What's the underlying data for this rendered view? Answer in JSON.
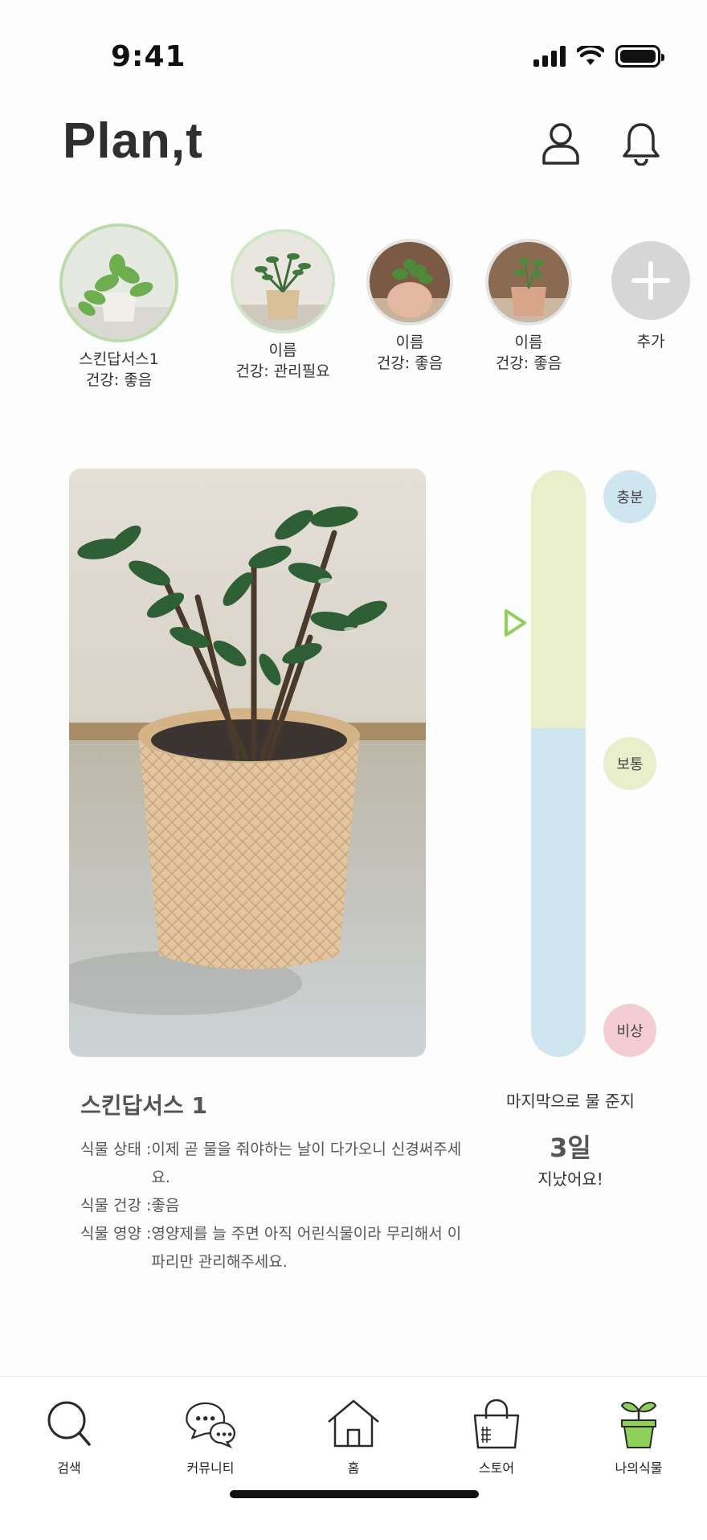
{
  "status_bar": {
    "time": "9:41"
  },
  "header": {
    "title": "Plan,t",
    "profile_icon": "profile-icon",
    "bell_icon": "bell-icon"
  },
  "plants": [
    {
      "name": "스킨답서스1",
      "health": "건강: 좋음",
      "selected": true
    },
    {
      "name": "이름",
      "health": "건강: 관리필요",
      "selected": false
    },
    {
      "name": "이름",
      "health": "건강: 좋음",
      "selected": false
    },
    {
      "name": "이름",
      "health": "건강: 좋음",
      "selected": false
    }
  ],
  "add_button": {
    "label": "추가",
    "icon": "plus-icon"
  },
  "gauge": {
    "labels": {
      "high": "충분",
      "mid": "보통",
      "low": "비상"
    },
    "colors": {
      "high": "#cfe5ef",
      "mid": "#e9eecb",
      "low": "#f3cdd3",
      "pointer": "#8fd05a"
    },
    "fill_top_fraction": 0.44,
    "pointer_fraction": 0.26
  },
  "detail": {
    "name": "스킨답서스 1",
    "rows": [
      {
        "key": "식물 상태 : ",
        "value": "이제 곧 물을 줘야하는 날이 다가오니 신경써주세요."
      },
      {
        "key": "식물 건강 : ",
        "value": "좋음"
      },
      {
        "key": "식물 영양 : ",
        "value": "영양제를 늘 주면 아직 어린식물이라 무리해서 이파리만 관리해주세요."
      }
    ]
  },
  "watering": {
    "label": "마지막으로 물 준지",
    "days": "3일",
    "suffix": "지났어요!"
  },
  "nav": [
    {
      "label": "검색",
      "icon": "search-icon"
    },
    {
      "label": "커뮤니티",
      "icon": "chat-icon"
    },
    {
      "label": "홈",
      "icon": "home-icon"
    },
    {
      "label": "스토어",
      "icon": "store-bag-icon"
    },
    {
      "label": "나의식물",
      "icon": "sprout-pot-icon"
    }
  ],
  "accent_color": "#8fd05a"
}
